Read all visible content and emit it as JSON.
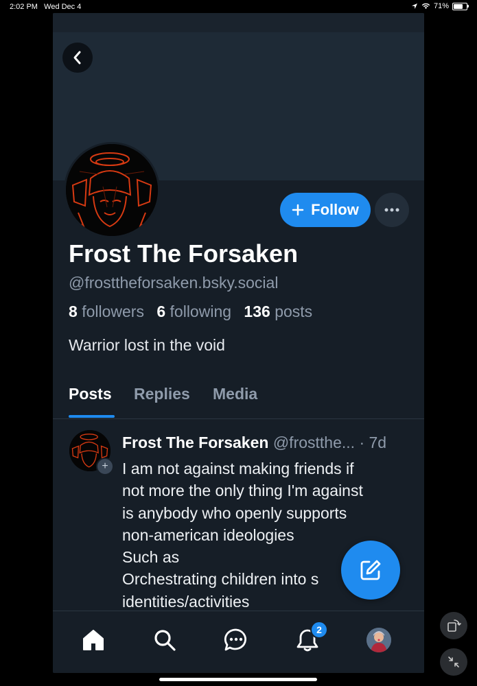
{
  "status_bar": {
    "time": "2:02 PM",
    "date": "Wed Dec 4",
    "battery": "71%"
  },
  "profile": {
    "display_name": "Frost The Forsaken",
    "handle": "@frosttheforsaken.bsky.social",
    "followers_count": "8",
    "followers_label": "followers",
    "following_count": "6",
    "following_label": "following",
    "posts_count": "136",
    "posts_label": "posts",
    "bio": "Warrior lost in the void",
    "follow_label": "Follow"
  },
  "tabs": [
    {
      "label": "Posts",
      "active": true
    },
    {
      "label": "Replies",
      "active": false
    },
    {
      "label": "Media",
      "active": false
    }
  ],
  "post": {
    "author": "Frost The Forsaken",
    "handle": "@frostthe...",
    "time": "· 7d",
    "lines": [
      "I am not against making friends if",
      "not more the only thing I'm against",
      "is anybody who openly supports",
      "non-american ideologies",
      "Such as",
      "Orchestrating children into s",
      "identities/activities"
    ]
  },
  "nav": {
    "notification_count": "2",
    "icons": [
      "home-icon",
      "search-icon",
      "chat-icon",
      "bell-icon",
      "avatar"
    ]
  },
  "colors": {
    "accent": "#1f8bef",
    "background": "#161e27",
    "banner": "#1e2a36"
  }
}
